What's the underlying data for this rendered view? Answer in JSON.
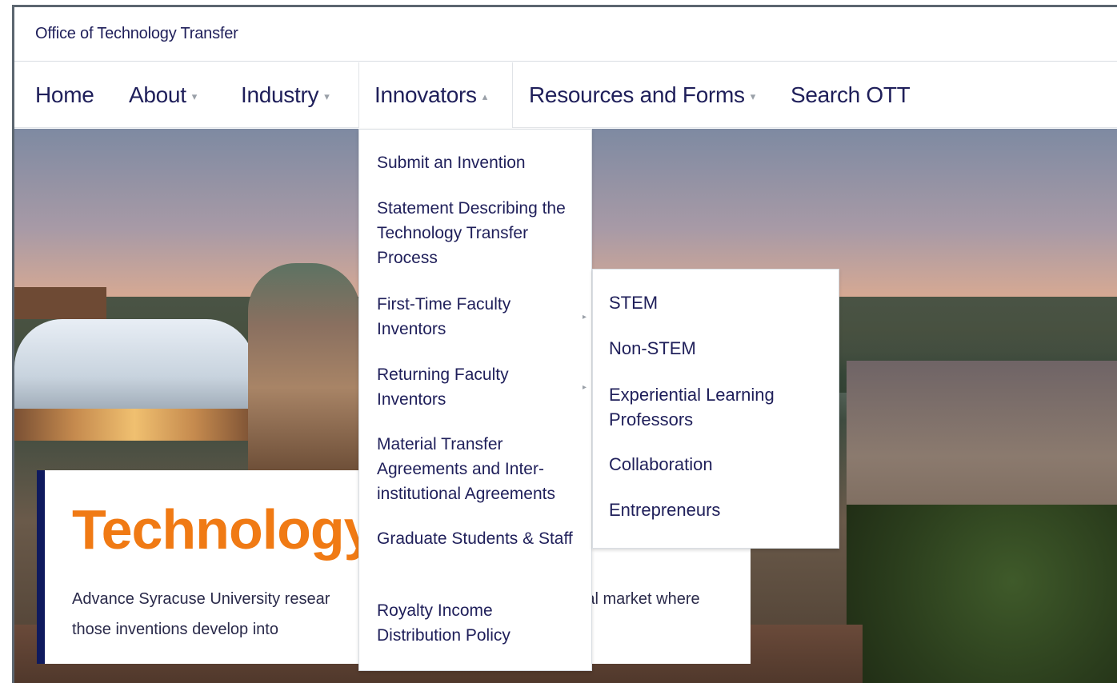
{
  "site": {
    "title": "Office of Technology Transfer"
  },
  "nav": {
    "items": [
      {
        "label": "Home",
        "caret": ""
      },
      {
        "label": "About",
        "caret": "▾"
      },
      {
        "label": "Industry",
        "caret": "▾"
      },
      {
        "label": "Innovators",
        "caret": "▴"
      },
      {
        "label": "Resources and Forms",
        "caret": "▾"
      },
      {
        "label": "Search OTT",
        "caret": ""
      }
    ]
  },
  "innovators_menu": {
    "items": [
      {
        "label": "Submit an Invention"
      },
      {
        "label": "Statement Describing the Technology Transfer Process"
      },
      {
        "label": "First-Time Faculty Inventors",
        "arrow": "▸"
      },
      {
        "label": "Returning Faculty Inventors",
        "arrow": "▸"
      },
      {
        "label": "Material Transfer Agreements and Inter-institutional Agreements"
      },
      {
        "label": "Graduate Students & Staff"
      },
      {
        "label": "Royalty Income Distribution Policy"
      }
    ]
  },
  "submenu": {
    "items": [
      {
        "label": "STEM"
      },
      {
        "label": "Non-STEM"
      },
      {
        "label": "Experiential Learning Professors"
      },
      {
        "label": "Collaboration"
      },
      {
        "label": "Entrepreneurs"
      }
    ]
  },
  "hero": {
    "heading": "Technology",
    "description": "Advance Syracuse University resear             nmercial market where those inventions develop into             enefit society."
  },
  "colors": {
    "accent_orange": "#f07a14",
    "navy": "#0f1a5e",
    "text": "#1f1f5a"
  }
}
